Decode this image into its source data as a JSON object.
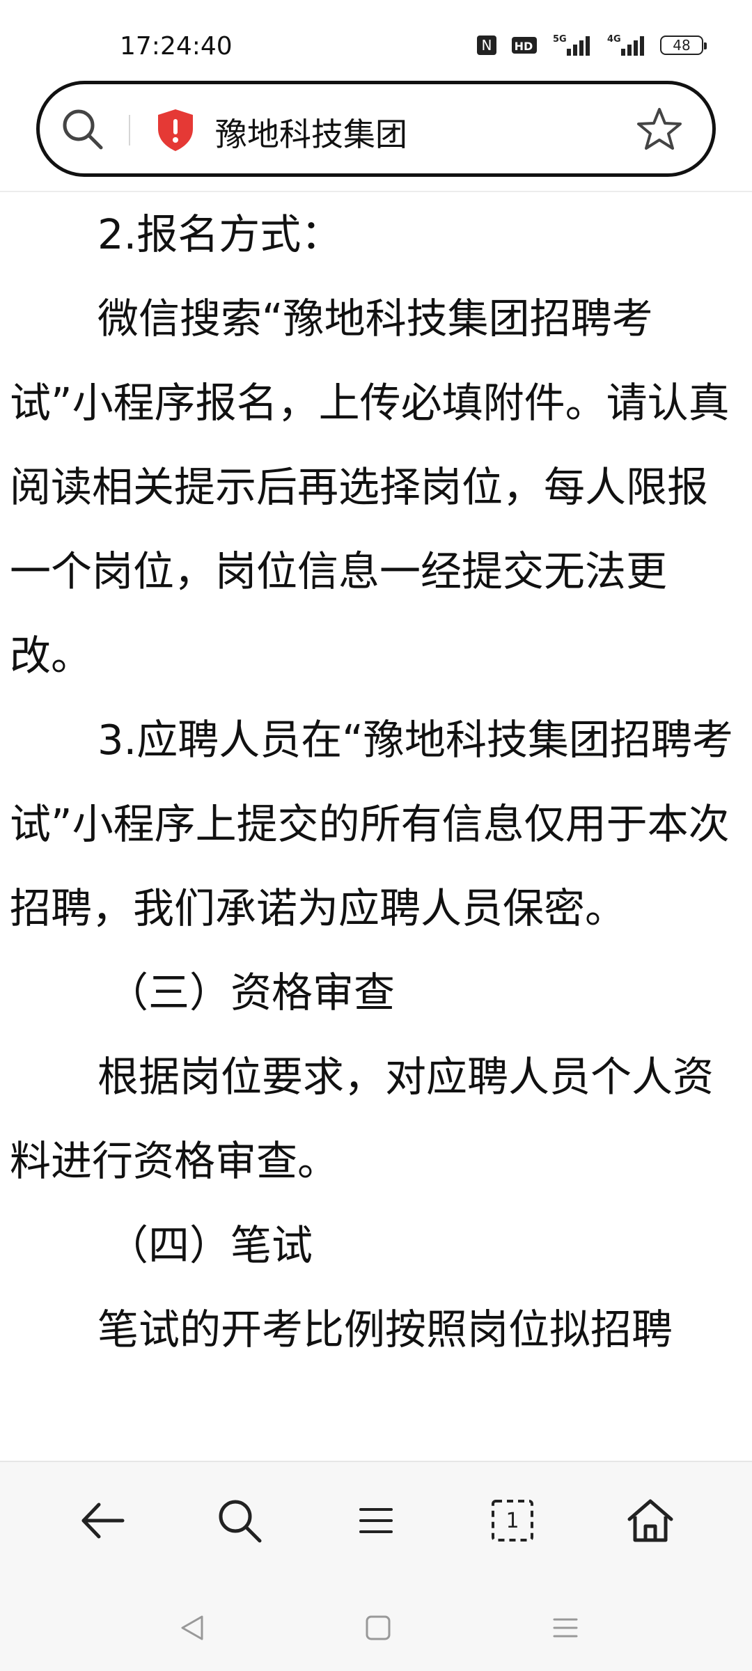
{
  "status_bar": {
    "time": "17:24:40",
    "nfc_label": "N",
    "hd_label": "HD",
    "net1_label": "5G",
    "net2_label": "4G",
    "battery": "48"
  },
  "address_bar": {
    "title": "豫地科技集团",
    "icons": [
      "search-icon",
      "security-warning-shield-icon",
      "star-icon"
    ]
  },
  "content": {
    "paragraphs": [
      "2.报名方式：",
      "微信搜索“豫地科技集团招聘考试”小程序报名，上传必填附件。请认真阅读相关提示后再选择岗位，每人限报一个岗位，岗位信息一经提交无法更改。",
      "3.应聘人员在“豫地科技集团招聘考试”小程序上提交的所有信息仅用于本次招聘，我们承诺为应聘人员保密。",
      "（三）资格审查",
      "根据岗位要求，对应聘人员个人资料进行资格审查。",
      "（四）笔试",
      "笔试的开考比例按照岗位拟招聘"
    ]
  },
  "toolbar": {
    "tab_count": "1",
    "icons": [
      "back-arrow-icon",
      "search-icon",
      "menu-icon",
      "tabs-icon",
      "home-icon"
    ]
  },
  "navbar": {
    "icons": [
      "nav-back-triangle-icon",
      "nav-home-square-icon",
      "nav-recents-icon"
    ]
  },
  "colors": {
    "shield_red": "#e53935",
    "toolbar_bg": "#f7f7f7",
    "text": "#111111"
  }
}
